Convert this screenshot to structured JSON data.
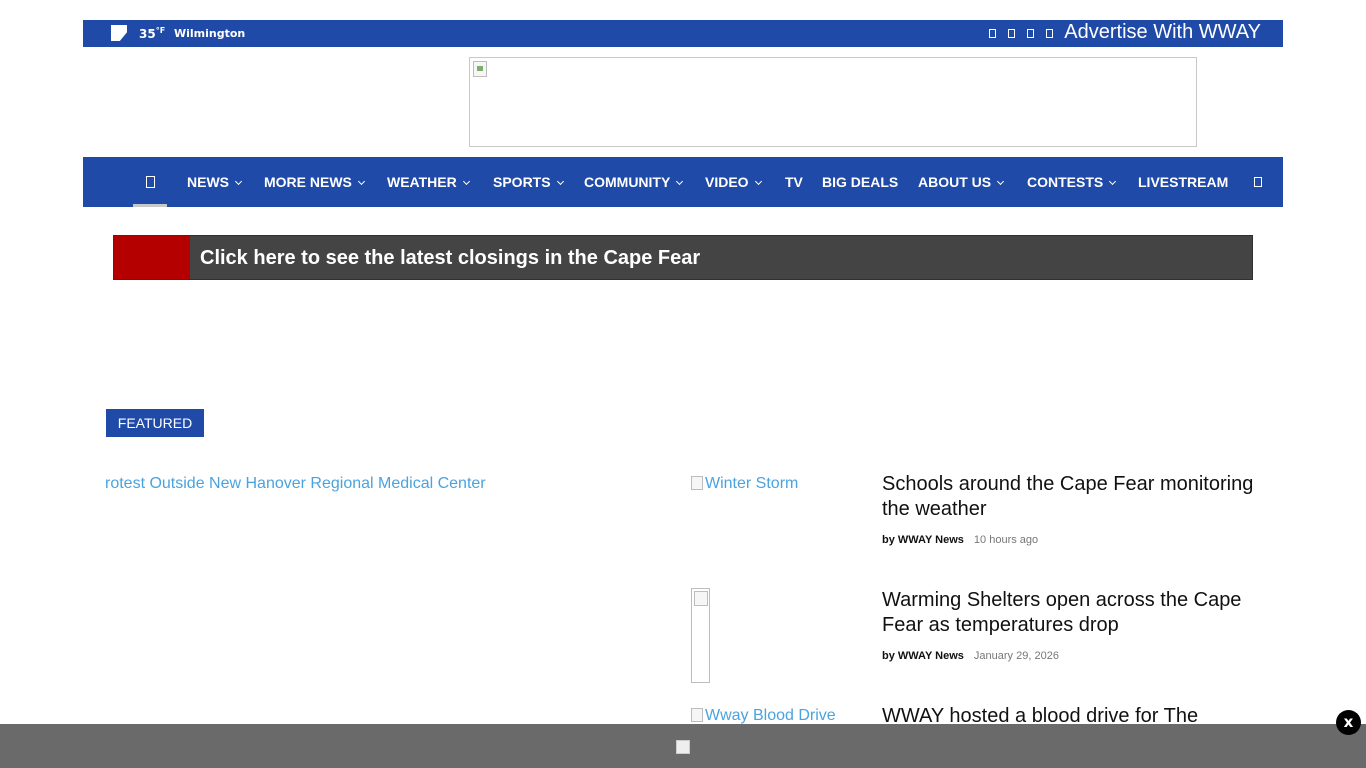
{
  "topbar": {
    "temperature": "35",
    "unit": "°F",
    "city": "Wilmington",
    "advertise": "Advertise With WWAY"
  },
  "nav": {
    "items": [
      {
        "label": "NEWS",
        "dropdown": true
      },
      {
        "label": "MORE NEWS",
        "dropdown": true
      },
      {
        "label": "WEATHER",
        "dropdown": true
      },
      {
        "label": "SPORTS",
        "dropdown": true
      },
      {
        "label": "COMMUNITY",
        "dropdown": true
      },
      {
        "label": "VIDEO",
        "dropdown": true
      },
      {
        "label": "TV",
        "dropdown": false
      },
      {
        "label": "BIG DEALS",
        "dropdown": false
      },
      {
        "label": "ABOUT US",
        "dropdown": true
      },
      {
        "label": "CONTESTS",
        "dropdown": true
      },
      {
        "label": "LIVESTREAM",
        "dropdown": false
      }
    ]
  },
  "banner": {
    "text": "Click here to see the latest closings in the Cape Fear"
  },
  "featured": {
    "tag": "FEATURED",
    "lead_alt": "rotest Outside New Hanover Regional Medical Center"
  },
  "stories": [
    {
      "image_alt": "Winter Storm",
      "title": "Schools around the Cape Fear monitoring the weather",
      "author": "by WWAY News",
      "date": "10 hours ago"
    },
    {
      "image_alt": "",
      "title": "Warming Shelters open across the Cape Fear as temperatures drop",
      "author": "by WWAY News",
      "date": "January 29, 2026"
    },
    {
      "image_alt": "Wway Blood Drive",
      "title": "WWAY hosted a blood drive for The American Red Cross",
      "author": "",
      "date": ""
    }
  ],
  "sticky": {
    "close": "x"
  },
  "colors": {
    "brand_blue": "#1f4aa8",
    "banner_red": "#b50000",
    "banner_gray": "#444444",
    "link_blue": "#4aa3df"
  }
}
